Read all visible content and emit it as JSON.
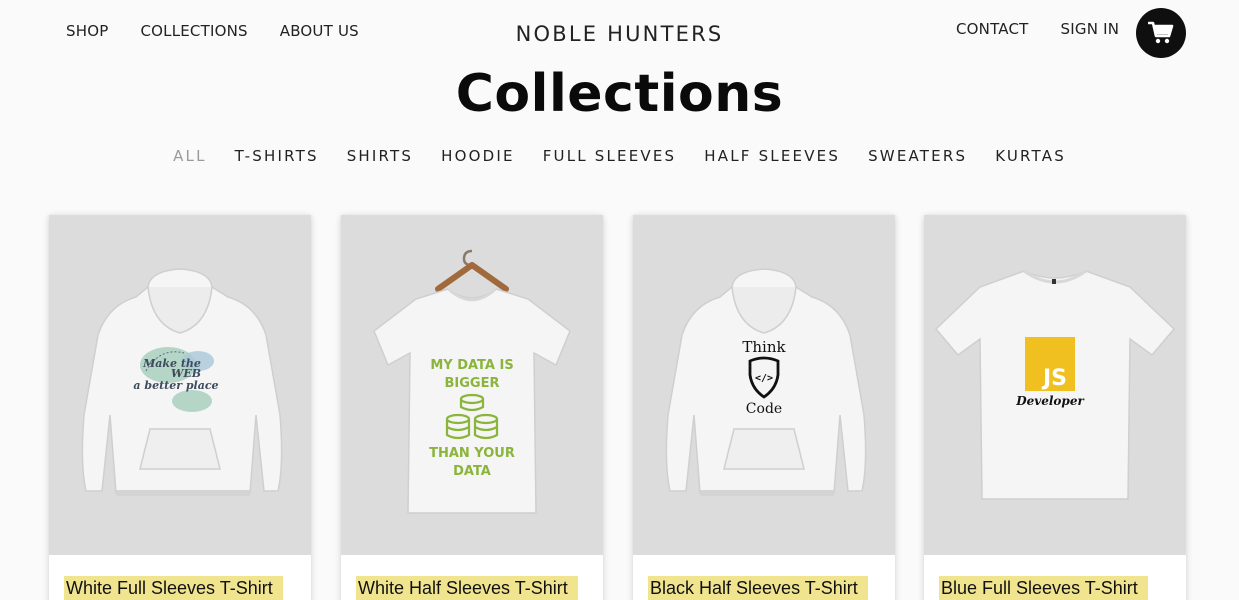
{
  "nav": {
    "left_links": [
      "SHOP",
      "COLLECTIONS",
      "ABOUT US"
    ],
    "brand": "NOBLE HUNTERS",
    "right_links": [
      "CONTACT",
      "SIGN IN"
    ],
    "cart_icon": "cart-icon"
  },
  "page_title": "Collections",
  "filters": {
    "items": [
      "ALL",
      "T-SHIRTS",
      "SHIRTS",
      "HOODIE",
      "FULL SLEEVES",
      "HALF SLEEVES",
      "SWEATERS",
      "KURTAS"
    ],
    "active": "ALL"
  },
  "products": [
    {
      "title": "White Full Sleeves T-Shirt",
      "garment": "hoodie",
      "print": [
        "Make the",
        "WEB",
        "a better place"
      ]
    },
    {
      "title": "White Half Sleeves T-Shirt",
      "garment": "tshirt-on-hanger",
      "print": [
        "MY DATA IS",
        "BIGGER",
        "THAN YOUR",
        "DATA"
      ]
    },
    {
      "title": "Black Half Sleeves T-Shirt",
      "garment": "hoodie",
      "print": [
        "Think",
        "</>",
        "Code"
      ]
    },
    {
      "title": "Blue Full Sleeves T-Shirt",
      "garment": "tshirt",
      "print": [
        "JS",
        "Developer"
      ]
    }
  ],
  "colors": {
    "background": "#fafafa",
    "card_image_bg": "#dcdcdc",
    "title_highlight": "#f0e48f",
    "cart_button": "#0f0f0f",
    "filter_active": "#9a9a9a",
    "print_green": "#8ab43a",
    "js_yellow": "#f0c020"
  }
}
